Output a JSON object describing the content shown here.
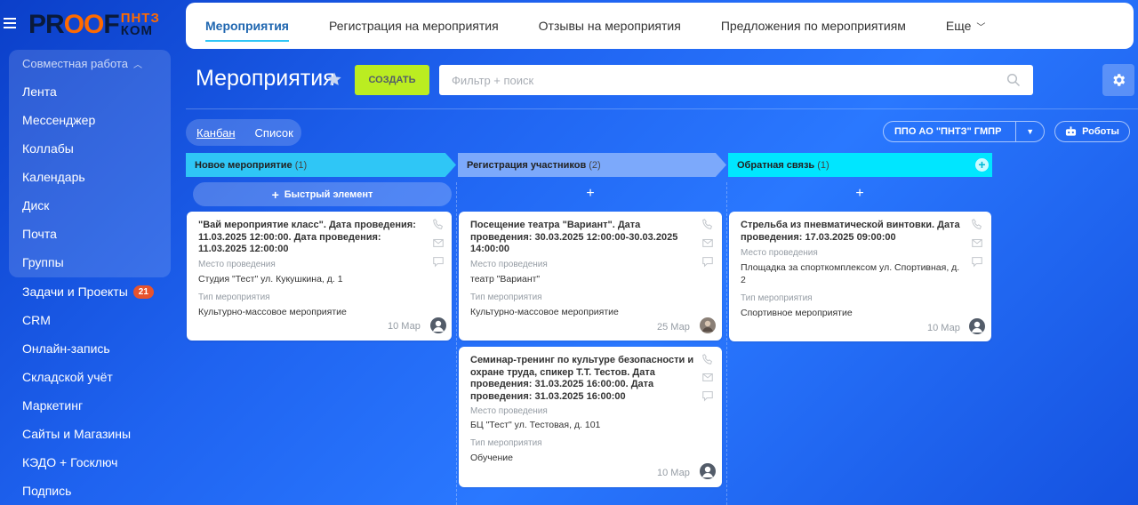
{
  "logo": {
    "main_a": "PR",
    "main_b": "OO",
    "main_c": "F",
    "sub_top": "ПНТЗ",
    "sub_bottom": "КОМ"
  },
  "sidebar": {
    "group_label": "Совместная работа",
    "items": [
      "Лента",
      "Мессенджер",
      "Коллабы",
      "Календарь",
      "Диск",
      "Почта",
      "Группы"
    ],
    "more": [
      {
        "label": "Задачи и Проекты",
        "badge": "21"
      },
      {
        "label": "CRM"
      },
      {
        "label": "Онлайн-запись"
      },
      {
        "label": "Складской учёт"
      },
      {
        "label": "Маркетинг"
      },
      {
        "label": "Сайты и Магазины"
      },
      {
        "label": "КЭДО + Госключ"
      },
      {
        "label": "Подпись"
      }
    ]
  },
  "tabs": [
    "Мероприятия",
    "Регистрация на мероприятия",
    "Отзывы на мероприятия",
    "Предложения по мероприятиям",
    "Еще"
  ],
  "page": {
    "title": "Мероприятия",
    "create_label": "СОЗДАТЬ",
    "search_placeholder": "Фильтр + поиск"
  },
  "views": {
    "kanban": "Канбан",
    "list": "Список"
  },
  "company_label": "ППО АО \"ПНТЗ\" ГМПР",
  "robots_label": "Роботы",
  "quick_add_label": "Быстрый элемент",
  "colors": {
    "accent": "#2fc6f6",
    "create": "#bbed21",
    "stage1": "#2fc6f6",
    "stage2": "#7ca9fb",
    "stage3": "#00e6ff"
  },
  "columns": [
    {
      "name": "Новое мероприятие",
      "count": "(1)"
    },
    {
      "name": "Регистрация участников",
      "count": "(2)"
    },
    {
      "name": "Обратная связь",
      "count": "(1)"
    }
  ],
  "cards": [
    {
      "title_lines": [
        "\"Вай мероприятие класс\". Дата проведения:",
        "11.03.2025 12:00:00. Дата проведения:",
        "11.03.2025 12:00:00"
      ],
      "place_label": "Место проведения",
      "place_lines": [
        "Студия \"Тест\" ул. Кукушкина, д. 1"
      ],
      "type_label": "Тип мероприятия",
      "type": "Культурно-массовое мероприятие",
      "date": "10 Мар"
    },
    {
      "title_lines": [
        "Посещение театра \"Вариант\". Дата",
        "проведения: 30.03.2025 12:00:00-30.03.2025",
        "14:00:00"
      ],
      "place_label": "Место проведения",
      "place_lines": [
        "театр \"Вариант\""
      ],
      "type_label": "Тип мероприятия",
      "type": "Культурно-массовое мероприятие",
      "date": "25 Мар"
    },
    {
      "title_lines": [
        "Семинар-тренинг по культуре безопасности и",
        "охране труда, спикер Т.Т. Тестов. Дата",
        "проведения: 31.03.2025 16:00:00. Дата",
        "проведения: 31.03.2025 16:00:00"
      ],
      "place_label": "Место проведения",
      "place_lines": [
        "БЦ \"Тест\" ул. Тестовая, д. 101"
      ],
      "type_label": "Тип мероприятия",
      "type": "Обучение",
      "date": "10 Мар"
    },
    {
      "title_lines": [
        "Стрельба из пневматической винтовки. Дата",
        "проведения: 17.03.2025 09:00:00"
      ],
      "place_label": "Место проведения",
      "place_lines": [
        "Площадка за спорткомплексом ул. Спортивная, д.",
        "2"
      ],
      "type_label": "Тип мероприятия",
      "type": "Спортивное мероприятие",
      "date": "10 Мар"
    }
  ]
}
